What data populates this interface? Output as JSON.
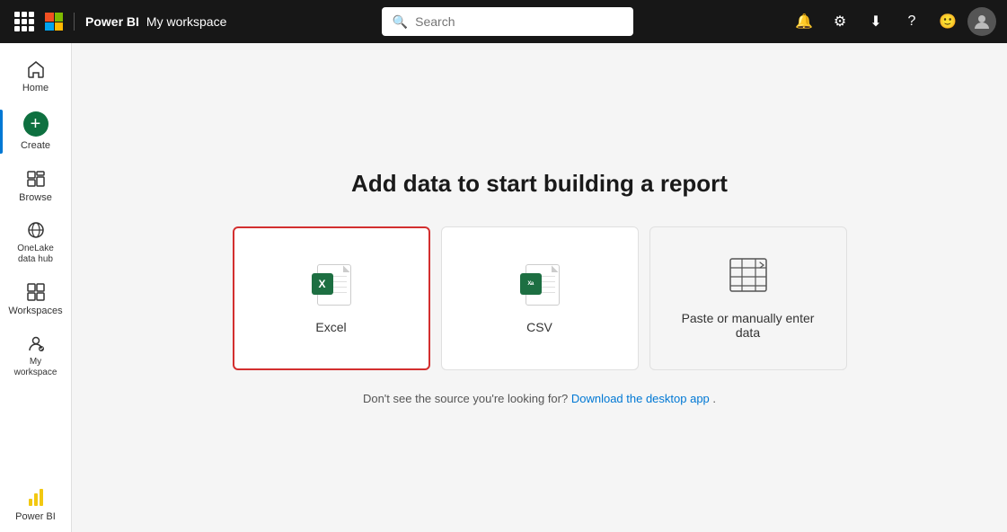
{
  "topbar": {
    "brand": "Power BI",
    "workspace_label": "My workspace",
    "search_placeholder": "Search",
    "icons": {
      "notifications": "🔔",
      "settings": "⚙",
      "download": "⬇",
      "help": "?",
      "feedback": "🙂"
    }
  },
  "sidebar": {
    "items": [
      {
        "id": "home",
        "label": "Home",
        "icon": "home"
      },
      {
        "id": "create",
        "label": "Create",
        "icon": "create"
      },
      {
        "id": "browse",
        "label": "Browse",
        "icon": "browse"
      },
      {
        "id": "onelake",
        "label": "OneLake data hub",
        "icon": "onelake"
      },
      {
        "id": "workspaces",
        "label": "Workspaces",
        "icon": "workspaces"
      },
      {
        "id": "myworkspace",
        "label": "My workspace",
        "icon": "myworkspace"
      }
    ],
    "bottom": [
      {
        "id": "powerbi",
        "label": "Power BI",
        "icon": "powerbi"
      }
    ]
  },
  "main": {
    "title": "Add data to start building a report",
    "cards": [
      {
        "id": "excel",
        "label": "Excel",
        "selected": true
      },
      {
        "id": "csv",
        "label": "CSV",
        "selected": false
      },
      {
        "id": "paste",
        "label": "Paste or manually enter\ndata",
        "selected": false
      }
    ],
    "footer": {
      "prefix": "Don't see the source you're looking for?",
      "link_text": "Download the desktop app",
      "suffix": "."
    }
  }
}
